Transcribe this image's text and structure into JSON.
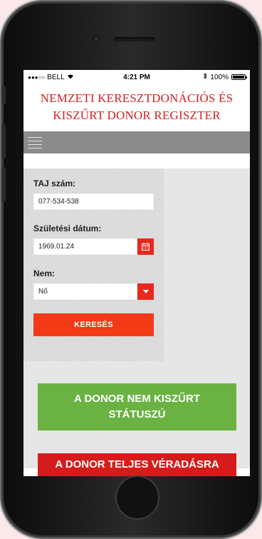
{
  "status_bar": {
    "signal_dots": "●●●○○",
    "carrier": "BELL",
    "wifi_icon": "wifi-icon",
    "time": "4:21 PM",
    "bluetooth_icon": "bluetooth-icon",
    "battery_text": "100%"
  },
  "header": {
    "title_line1": "NEMZETI KERESZTDONÁCIÓS ÉS",
    "title_line2": "KISZŰRT DONOR REGISZTER"
  },
  "nav": {
    "menu_icon": "hamburger-icon"
  },
  "form": {
    "taj": {
      "label": "TAJ szám:",
      "value": "077-534-538"
    },
    "birth": {
      "label": "Születési dátum:",
      "value": "1969.01.24",
      "icon": "calendar-icon"
    },
    "gender": {
      "label": "Nem:",
      "value": "Nő",
      "icon": "chevron-down-icon"
    },
    "search_label": "KERESÉS"
  },
  "results": {
    "green_status": "A DONOR NEM KISZŰRT STÁTUSZÚ",
    "red_status": "A DONOR TELJES VÉRADÁSRA"
  },
  "colors": {
    "accent_red": "#e8281e",
    "title_red": "#d4201f",
    "green": "#6ab342",
    "navbar_gray": "#8b8b8b"
  }
}
